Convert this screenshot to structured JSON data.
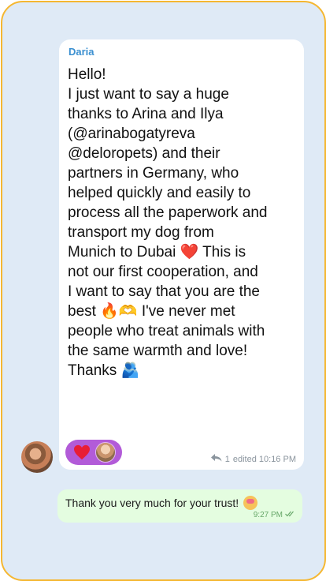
{
  "incoming": {
    "sender": "Daria",
    "lines": [
      "Hello!",
      "I just want to say a huge",
      "thanks to Arina and Ilya",
      "(@arinabogatyreva",
      "@deloropets) and their",
      "partners in Germany, who",
      "helped quickly and easily to",
      "process all the paperwork and",
      "transport my dog from",
      "Munich to Dubai",
      " This is",
      "not our first cooperation, and",
      "I want to say that you are the",
      "best ",
      " I've never met",
      "people who treat animals with",
      "the same warmth and love!",
      "Thanks "
    ],
    "emoji_heart": "❤️",
    "emoji_fire": "🔥",
    "emoji_heart_hands": "🫶",
    "emoji_hug": "🫂",
    "replies_count": "1",
    "edited_time": "edited 10:16 PM",
    "reaction_icon": "heart-icon"
  },
  "outgoing": {
    "text": "Thank you very much for your trust!",
    "time": "9:27 PM",
    "status_icon": "double-check-icon"
  },
  "colors": {
    "frame_border": "#f5b731",
    "background": "#dfeaf6",
    "sender_name": "#3a8fd0",
    "reaction_pill": "#b25bd8",
    "outgoing_bubble": "#e4fde0"
  }
}
